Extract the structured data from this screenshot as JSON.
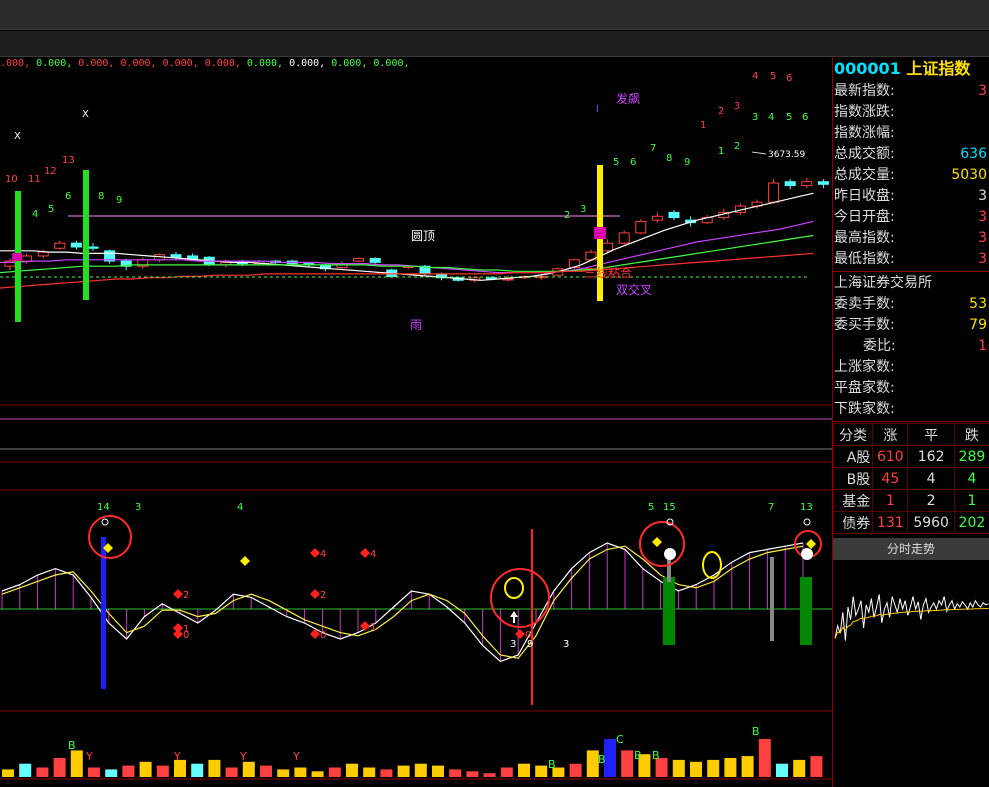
{
  "indicator_values": [
    {
      "text": ".000,",
      "color": "#ff4040"
    },
    {
      "text": " 0.000,",
      "color": "#40ff40"
    },
    {
      "text": " 0.000,",
      "color": "#ff4040"
    },
    {
      "text": " 0.000,",
      "color": "#ff4040"
    },
    {
      "text": " 0.000,",
      "color": "#ff4040"
    },
    {
      "text": " 0.000,",
      "color": "#ff4040"
    },
    {
      "text": " 0.000,",
      "color": "#40ff40"
    },
    {
      "text": " 0.000,",
      "color": "#ffffff"
    },
    {
      "text": " 0.000,",
      "color": "#40ff40"
    },
    {
      "text": " 0.000,",
      "color": "#40ff40"
    }
  ],
  "chart_data": {
    "type": "candlestick",
    "price_annotation": "3673.59",
    "text_labels": [
      "圆顶",
      "雨",
      "发飙",
      "三线粘合",
      "双交叉"
    ],
    "candles": [
      {
        "o": 10,
        "c": 14,
        "h": 16,
        "l": 7
      },
      {
        "o": 14,
        "c": 18,
        "h": 20,
        "l": 12
      },
      {
        "o": 18,
        "c": 21,
        "h": 23,
        "l": 16
      },
      {
        "o": 24,
        "c": 28,
        "h": 30,
        "l": 23
      },
      {
        "o": 28,
        "c": 25,
        "h": 30,
        "l": 23
      },
      {
        "o": 25,
        "c": 24,
        "h": 28,
        "l": 22
      },
      {
        "o": 22,
        "c": 14,
        "h": 23,
        "l": 12
      },
      {
        "o": 14,
        "c": 10,
        "h": 16,
        "l": 7
      },
      {
        "o": 10,
        "c": 15,
        "h": 17,
        "l": 8
      },
      {
        "o": 15,
        "c": 19,
        "h": 20,
        "l": 13
      },
      {
        "o": 19,
        "c": 17,
        "h": 21,
        "l": 15
      },
      {
        "o": 18,
        "c": 15,
        "h": 20,
        "l": 14
      },
      {
        "o": 17,
        "c": 11,
        "h": 18,
        "l": 10
      },
      {
        "o": 11,
        "c": 13,
        "h": 15,
        "l": 9
      },
      {
        "o": 13,
        "c": 12,
        "h": 15,
        "l": 10
      },
      {
        "o": 12,
        "c": 14,
        "h": 15,
        "l": 11
      },
      {
        "o": 14,
        "c": 13,
        "h": 15,
        "l": 12
      },
      {
        "o": 14,
        "c": 12,
        "h": 15,
        "l": 11
      },
      {
        "o": 12,
        "c": 11,
        "h": 13,
        "l": 9
      },
      {
        "o": 11,
        "c": 8,
        "h": 12,
        "l": 6
      },
      {
        "o": 9,
        "c": 12,
        "h": 14,
        "l": 8
      },
      {
        "o": 14,
        "c": 16,
        "h": 17,
        "l": 13
      },
      {
        "o": 16,
        "c": 13,
        "h": 17,
        "l": 12
      },
      {
        "o": 7,
        "c": 2,
        "h": 8,
        "l": 1
      },
      {
        "o": 9,
        "c": 10,
        "h": 11,
        "l": 8
      },
      {
        "o": 10,
        "c": 4,
        "h": 11,
        "l": 3
      },
      {
        "o": 4,
        "c": 1,
        "h": 5,
        "l": -1
      },
      {
        "o": 1,
        "c": -1,
        "h": 2,
        "l": -2
      },
      {
        "o": -1,
        "c": 1,
        "h": 2,
        "l": -3
      },
      {
        "o": 1,
        "c": 0,
        "h": 2,
        "l": -1
      },
      {
        "o": 0,
        "c": 0,
        "h": 3,
        "l": -2
      },
      {
        "o": 1,
        "c": 2,
        "h": 3,
        "l": 0
      },
      {
        "o": 1,
        "c": 2,
        "h": 4,
        "l": -1
      },
      {
        "o": 3,
        "c": 8,
        "h": 9,
        "l": 2
      },
      {
        "o": 9,
        "c": 15,
        "h": 16,
        "l": 8
      },
      {
        "o": 15,
        "c": 21,
        "h": 23,
        "l": 14
      },
      {
        "o": 22,
        "c": 28,
        "h": 31,
        "l": 20
      },
      {
        "o": 28,
        "c": 36,
        "h": 38,
        "l": 27
      },
      {
        "o": 36,
        "c": 45,
        "h": 47,
        "l": 35
      },
      {
        "o": 46,
        "c": 49,
        "h": 52,
        "l": 44
      },
      {
        "o": 52,
        "c": 48,
        "h": 54,
        "l": 46
      },
      {
        "o": 46,
        "c": 44,
        "h": 49,
        "l": 41
      },
      {
        "o": 44,
        "c": 48,
        "h": 50,
        "l": 43
      },
      {
        "o": 48,
        "c": 52,
        "h": 55,
        "l": 46
      },
      {
        "o": 52,
        "c": 57,
        "h": 59,
        "l": 50
      },
      {
        "o": 57,
        "c": 60,
        "h": 62,
        "l": 55
      },
      {
        "o": 60,
        "c": 75,
        "h": 78,
        "l": 59
      },
      {
        "o": 76,
        "c": 73,
        "h": 78,
        "l": 70
      },
      {
        "o": 73,
        "c": 76,
        "h": 79,
        "l": 71
      },
      {
        "o": 76,
        "c": 74,
        "h": 78,
        "l": 71
      }
    ],
    "ma_white": [
      22,
      22,
      22,
      21,
      21,
      20,
      20,
      20,
      19,
      18,
      17,
      16,
      15,
      14,
      13,
      13,
      12,
      11,
      10,
      9,
      8,
      7,
      6,
      5,
      4,
      3,
      2,
      1,
      0,
      -1,
      0,
      1,
      2,
      4,
      7,
      11,
      17,
      23,
      28,
      33,
      38,
      42,
      46,
      49,
      52,
      55,
      58,
      61,
      64,
      67
    ],
    "ma_purple": [
      13,
      13,
      14,
      14,
      15,
      15,
      15,
      15,
      15,
      15,
      15,
      15,
      14,
      14,
      14,
      14,
      14,
      13,
      13,
      13,
      12,
      12,
      12,
      11,
      11,
      10,
      9,
      8,
      7,
      6,
      5,
      5,
      5,
      5,
      6,
      8,
      11,
      14,
      17,
      20,
      23,
      26,
      29,
      31,
      33,
      35,
      37,
      39,
      42,
      45
    ],
    "ma_green": [
      5,
      6,
      7,
      8,
      9,
      10,
      10,
      10,
      11,
      11,
      11,
      11,
      11,
      11,
      11,
      11,
      11,
      11,
      11,
      11,
      11,
      11,
      11,
      10,
      10,
      10,
      9,
      9,
      8,
      7,
      7,
      6,
      6,
      6,
      6,
      7,
      8,
      10,
      12,
      14,
      16,
      18,
      20,
      22,
      24,
      26,
      28,
      30,
      32,
      34
    ],
    "ma_red": [
      -7,
      -6,
      -5,
      -4,
      -3,
      -2,
      -1,
      0,
      0,
      1,
      1,
      2,
      2,
      3,
      3,
      3,
      4,
      4,
      4,
      4,
      4,
      4,
      4,
      4,
      4,
      4,
      4,
      4,
      4,
      4,
      4,
      5,
      5,
      5,
      6,
      6,
      7,
      8,
      9,
      10,
      11,
      12,
      13,
      14,
      15,
      16,
      17,
      18,
      19,
      20
    ],
    "osc_white": [
      5,
      7,
      10,
      12,
      10,
      3,
      -5,
      -10,
      -3,
      1,
      -2,
      -5,
      -1,
      4,
      3,
      0,
      -3,
      -5,
      -8,
      -10,
      -8,
      -5,
      0,
      5,
      4,
      0,
      -5,
      -12,
      -17,
      -15,
      -5,
      5,
      12,
      17,
      20,
      18,
      12,
      8,
      5,
      7,
      10,
      14,
      17,
      18,
      19,
      20
    ],
    "osc_yellow": [
      4,
      6,
      8,
      10,
      11,
      5,
      -2,
      -8,
      -6,
      -1,
      -1,
      -3,
      -2,
      2,
      4,
      2,
      -1,
      -4,
      -6,
      -8,
      -9,
      -7,
      -3,
      2,
      4,
      2,
      -2,
      -9,
      -15,
      -16,
      -9,
      2,
      9,
      15,
      18,
      19,
      15,
      10,
      7,
      6,
      8,
      12,
      15,
      17,
      18,
      19
    ],
    "volumes": [
      {
        "v": 4,
        "c": "#ffcc00"
      },
      {
        "v": 7,
        "c": "#66ffff"
      },
      {
        "v": 5,
        "c": "#ff4040"
      },
      {
        "v": 10,
        "c": "#ff4040"
      },
      {
        "v": 14,
        "c": "#ffcc00"
      },
      {
        "v": 5,
        "c": "#ff4040"
      },
      {
        "v": 4,
        "c": "#66ffff"
      },
      {
        "v": 6,
        "c": "#ff4040"
      },
      {
        "v": 8,
        "c": "#ffcc00"
      },
      {
        "v": 6,
        "c": "#ff4040"
      },
      {
        "v": 9,
        "c": "#ffcc00"
      },
      {
        "v": 7,
        "c": "#66ffff"
      },
      {
        "v": 9,
        "c": "#ffcc00"
      },
      {
        "v": 5,
        "c": "#ff4040"
      },
      {
        "v": 8,
        "c": "#ffcc00"
      },
      {
        "v": 6,
        "c": "#ff4040"
      },
      {
        "v": 4,
        "c": "#ffcc00"
      },
      {
        "v": 5,
        "c": "#ffcc00"
      },
      {
        "v": 3,
        "c": "#ffcc00"
      },
      {
        "v": 5,
        "c": "#ff4040"
      },
      {
        "v": 7,
        "c": "#ffcc00"
      },
      {
        "v": 5,
        "c": "#ffcc00"
      },
      {
        "v": 4,
        "c": "#ff4040"
      },
      {
        "v": 6,
        "c": "#ffcc00"
      },
      {
        "v": 7,
        "c": "#ffcc00"
      },
      {
        "v": 6,
        "c": "#ffcc00"
      },
      {
        "v": 4,
        "c": "#ff4040"
      },
      {
        "v": 3,
        "c": "#ff4040"
      },
      {
        "v": 2,
        "c": "#ff4040"
      },
      {
        "v": 5,
        "c": "#ff4040"
      },
      {
        "v": 7,
        "c": "#ffcc00"
      },
      {
        "v": 6,
        "c": "#ffcc00"
      },
      {
        "v": 5,
        "c": "#ffcc00"
      },
      {
        "v": 7,
        "c": "#ff4040"
      },
      {
        "v": 14,
        "c": "#ffcc00"
      },
      {
        "v": 20,
        "c": "#2020ff"
      },
      {
        "v": 14,
        "c": "#ff4040"
      },
      {
        "v": 12,
        "c": "#ffcc00"
      },
      {
        "v": 10,
        "c": "#ff4040"
      },
      {
        "v": 9,
        "c": "#ffcc00"
      },
      {
        "v": 8,
        "c": "#ffcc00"
      },
      {
        "v": 9,
        "c": "#ffcc00"
      },
      {
        "v": 10,
        "c": "#ffcc00"
      },
      {
        "v": 11,
        "c": "#ffcc00"
      },
      {
        "v": 20,
        "c": "#ff4040"
      },
      {
        "v": 7,
        "c": "#66ffff"
      },
      {
        "v": 9,
        "c": "#ffcc00"
      },
      {
        "v": 11,
        "c": "#ff4040"
      }
    ]
  },
  "sidepanel": {
    "code": "000001",
    "name": "上证指数",
    "rows1": [
      {
        "label": "最新指数:",
        "value": "3",
        "color": "#ff4040"
      },
      {
        "label": "指数涨跌:",
        "value": "",
        "color": "#ff4040"
      },
      {
        "label": "指数涨幅:",
        "value": "",
        "color": "#ff4040"
      },
      {
        "label": "总成交额:",
        "value": "636",
        "color": "#00e0ff"
      },
      {
        "label": "总成交量:",
        "value": "5030",
        "color": "#ffe000"
      },
      {
        "label": "昨日收盘:",
        "value": "3",
        "color": "#ddd"
      },
      {
        "label": "今日开盘:",
        "value": "3",
        "color": "#ff4040"
      },
      {
        "label": "最高指数:",
        "value": "3",
        "color": "#ff4040"
      },
      {
        "label": "最低指数:",
        "value": "3",
        "color": "#ff4040"
      }
    ],
    "exchange": "上海证券交易所",
    "rows2": [
      {
        "label": "委卖手数:",
        "value": "53",
        "color": "#ffe000"
      },
      {
        "label": "委买手数:",
        "value": "79",
        "color": "#ffe000"
      },
      {
        "label": "委比:",
        "value": "1",
        "color": "#ff4040"
      },
      {
        "label": "上涨家数:",
        "value": "",
        "color": "#ff4040"
      },
      {
        "label": "平盘家数:",
        "value": "",
        "color": "#ddd"
      },
      {
        "label": "下跌家数:",
        "value": "",
        "color": "#40ff40"
      }
    ],
    "table_header": [
      "分类",
      "涨",
      "平",
      "跌"
    ],
    "table_rows": [
      {
        "cat": "A股",
        "up": "610",
        "flat": "162",
        "down": "289"
      },
      {
        "cat": "B股",
        "up": "45",
        "flat": "4",
        "down": "4"
      },
      {
        "cat": "基金",
        "up": "1",
        "flat": "2",
        "down": "1"
      },
      {
        "cat": "债券",
        "up": "131",
        "flat": "5960",
        "down": "202"
      }
    ],
    "tab_label": "分时走势",
    "mini_series": [
      30,
      42,
      35,
      55,
      28,
      60,
      48,
      70,
      52,
      58,
      66,
      40,
      62,
      55,
      68,
      50,
      60,
      72,
      45,
      58,
      64,
      50,
      70,
      62,
      55,
      68,
      58,
      66,
      52,
      60,
      70,
      58,
      65,
      48,
      62,
      68,
      55,
      60,
      64,
      58,
      66,
      62,
      70,
      56,
      62,
      66,
      58,
      63,
      60,
      65,
      62,
      58,
      64,
      60,
      66,
      62,
      60,
      64,
      62,
      63
    ]
  }
}
